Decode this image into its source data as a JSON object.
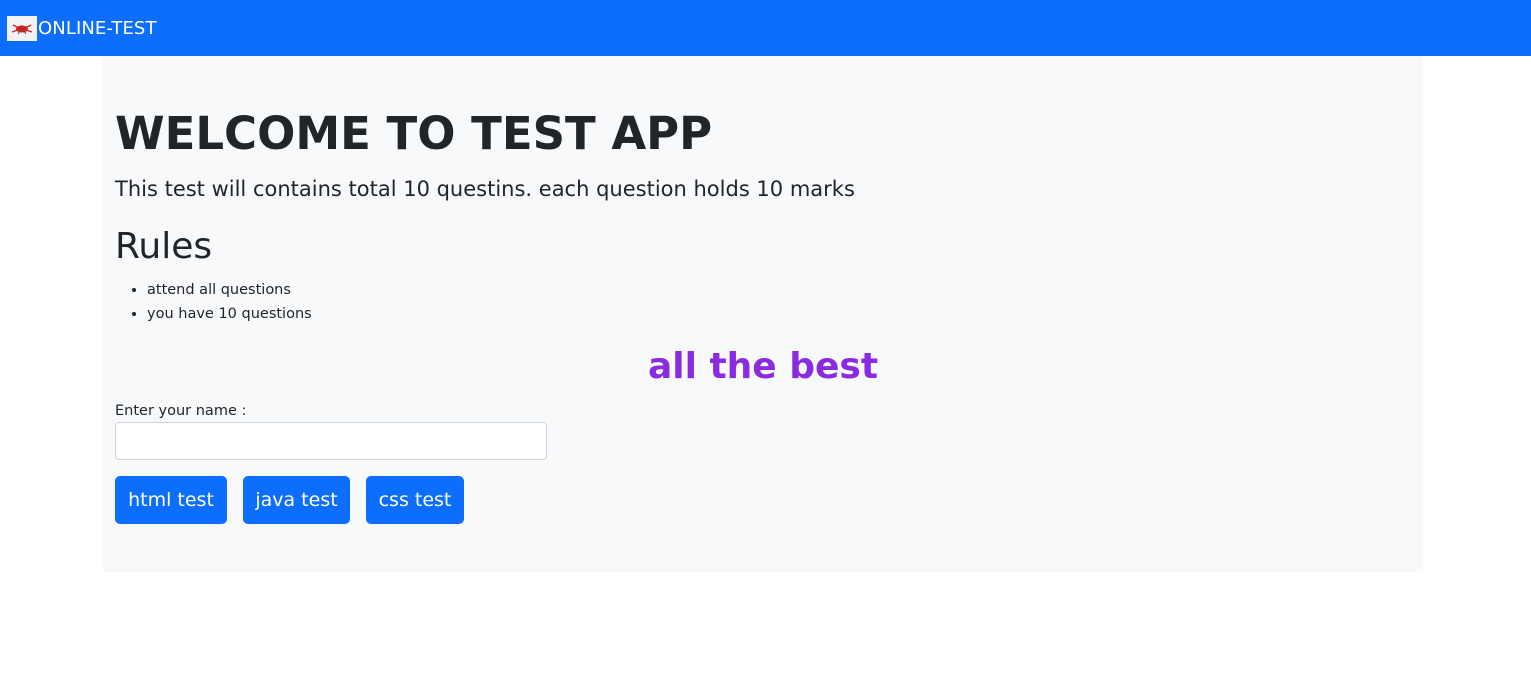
{
  "navbar": {
    "brand_text": "ONLINE-TEST",
    "logo_icon": "bug-logo-icon"
  },
  "main": {
    "title": "WELCOME TO TEST APP",
    "lead": "This test will contains total 10 questins. each question holds 10 marks",
    "rules_heading": "Rules",
    "rules": [
      "attend all questions",
      "you have 10 questions"
    ],
    "wish": "all the best",
    "name_label": "Enter your name :",
    "name_value": "",
    "buttons": {
      "html": "html test",
      "java": "java test",
      "css": "css test"
    }
  },
  "colors": {
    "primary": "#0d6efd",
    "jumbotron_bg": "#f8f9fa",
    "wish_text": "#8a2be2"
  }
}
